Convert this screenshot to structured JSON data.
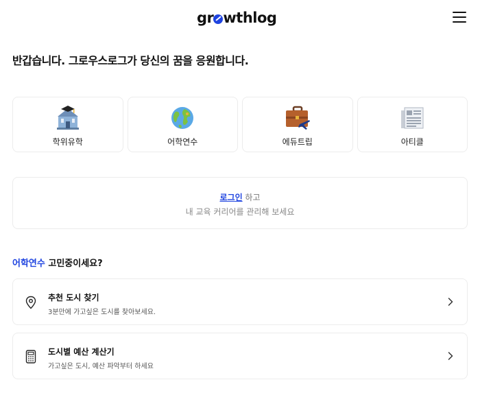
{
  "header": {
    "logo_text_pre": "gr",
    "logo_text_post": "wthlog",
    "menu_icon": "hamburger-menu-icon"
  },
  "greeting": "반갑습니다. 그로우스로그가 당신의 꿈을 응원합니다.",
  "categories": [
    {
      "label": "학위유학",
      "icon": "university-building-icon"
    },
    {
      "label": "어학연수",
      "icon": "globe-icon"
    },
    {
      "label": "에듀트립",
      "icon": "briefcase-airplane-icon"
    },
    {
      "label": "아티클",
      "icon": "newspaper-icon"
    }
  ],
  "login_prompt": {
    "link": "로그인",
    "suffix": " 하고",
    "line2": "내 교육 커리어를 관리해 보세요"
  },
  "section": {
    "accent": "어학연수",
    "rest": " 고민중이세요?"
  },
  "tools": [
    {
      "title": "추천 도시 찾기",
      "desc": "3분만에 가고싶은 도시를 찾아보세요.",
      "icon": "location-pin-icon"
    },
    {
      "title": "도시별 예산 계산기",
      "desc": "가고싶은 도시, 예산 파악부터 하세요",
      "icon": "calculator-icon"
    }
  ],
  "colors": {
    "accent": "#1f44e0",
    "border": "#ececec",
    "text": "#111111"
  }
}
